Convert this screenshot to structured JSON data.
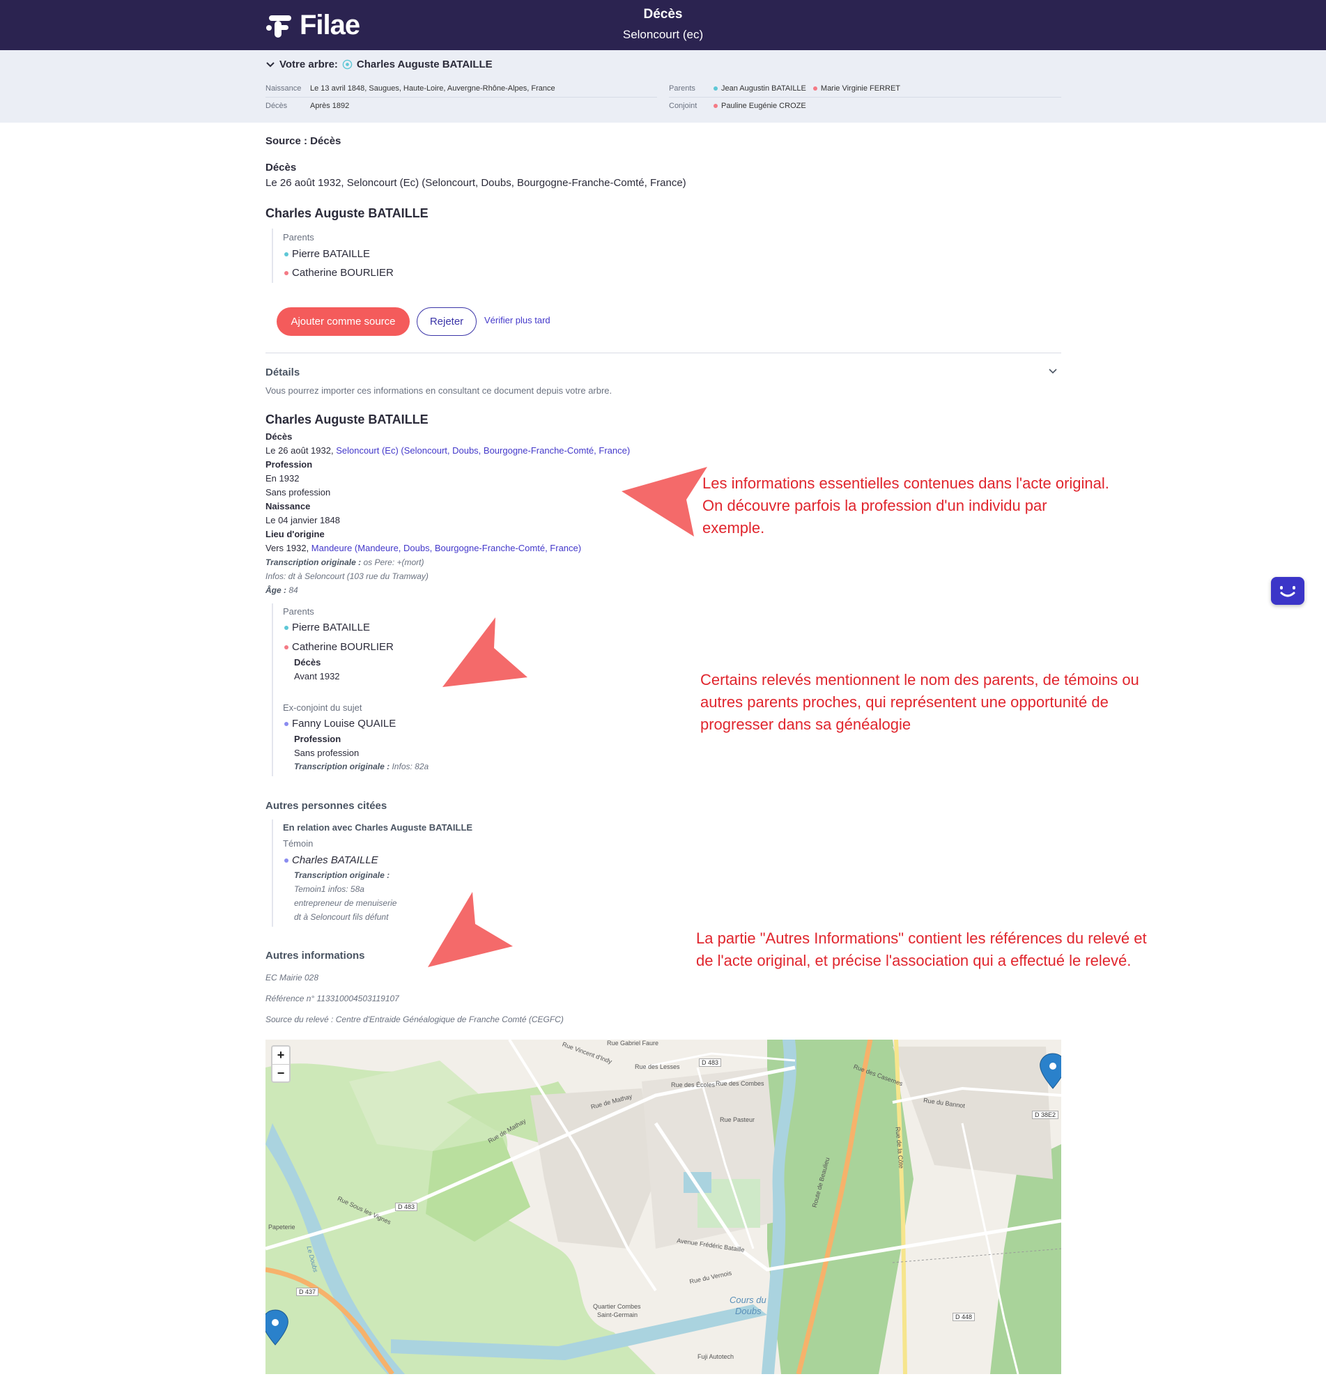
{
  "header": {
    "logo_text": "Filae",
    "title": "Décès",
    "subtitle": "Seloncourt (ec)"
  },
  "tree": {
    "heading_label": "Votre arbre:",
    "person_name": "Charles Auguste BATAILLE",
    "birth_label": "Naissance",
    "birth_value": "Le 13 avril 1848, Saugues, Haute-Loire, Auvergne-Rhône-Alpes, France",
    "death_label": "Décès",
    "death_value": "Après 1892",
    "parents_label": "Parents",
    "father": "Jean Augustin BATAILLE",
    "mother": "Marie Virginie FERRET",
    "spouse_label": "Conjoint",
    "spouse": "Pauline Eugénie CROZE"
  },
  "source": {
    "label": "Source : Décès",
    "event_label": "Décès",
    "event_value": "Le 26 août 1932, Seloncourt (Ec) (Seloncourt, Doubs, Bourgogne-Franche-Comté, France)",
    "person_name": "Charles Auguste BATAILLE",
    "parents_label": "Parents",
    "father": "Pierre BATAILLE",
    "mother": "Catherine BOURLIER"
  },
  "actions": {
    "add_label": "Ajouter comme source",
    "reject_label": "Rejeter",
    "later_label": "Vérifier plus tard"
  },
  "details": {
    "title": "Détails",
    "subtitle": "Vous pourrez importer ces informations en consultant ce document depuis votre arbre.",
    "person_name": "Charles Auguste BATAILLE",
    "death_label": "Décès",
    "death_prefix": "Le 26 août 1932, ",
    "death_place": "Seloncourt (Ec) (Seloncourt, Doubs, Bourgogne-Franche-Comté, France)",
    "profession_label": "Profession",
    "profession_year": "En 1932",
    "profession_value": "Sans profession",
    "birth_label": "Naissance",
    "birth_value": "Le 04 janvier 1848",
    "origin_label": "Lieu d'origine",
    "origin_prefix": "Vers 1932, ",
    "origin_place": "Mandeure (Mandeure, Doubs, Bourgogne-Franche-Comté, France)",
    "transcription_label": "Transcription originale :",
    "transcription_value": " os Pere: +(mort)",
    "infos_value": "Infos: dt à Seloncourt (103 rue du Tramway)",
    "age_label": "Âge :",
    "age_value": " 84",
    "parents_label": "Parents",
    "father": "Pierre BATAILLE",
    "mother": "Catherine BOURLIER",
    "mother_death_label": "Décès",
    "mother_death_value": "Avant 1932",
    "exspouse_label": "Ex-conjoint du sujet",
    "exspouse_name": "Fanny Louise QUAILE",
    "exspouse_prof_label": "Profession",
    "exspouse_prof_value": "Sans profession",
    "exspouse_trans_label": "Transcription originale :",
    "exspouse_trans_value": " Infos: 82a"
  },
  "others": {
    "title": "Autres personnes citées",
    "relation_label": "En relation avec Charles Auguste BATAILLE",
    "role": "Témoin",
    "name": "Charles BATAILLE",
    "trans_label": "Transcription originale :",
    "line1": "Temoin1 infos: 58a",
    "line2": "entrepreneur de menuiserie",
    "line3": "dt à Seloncourt fils défunt"
  },
  "more_info": {
    "title": "Autres informations",
    "line1": "EC Mairie 028",
    "line2": "Référence n° 113310004503119107",
    "line3": "Source du relevé : Centre d'Entraide Généalogique de Franche Comté (CEGFC)"
  },
  "annotations": {
    "a1_line1": "Les informations essentielles contenues dans l'acte original.",
    "a1_line2": "On découvre parfois la profession d'un individu par",
    "a1_line3": "exemple.",
    "a2_line1": "Certains relevés mentionnent le nom des parents, de témoins ou",
    "a2_line2": "autres parents proches, qui représentent une opportunité de",
    "a2_line3": "progresser dans sa généalogie",
    "a3_line1": "La partie \"Autres Informations\" contient les références du relevé et",
    "a3_line2": "de l'acte original, et précise l'association qui a effectué le relevé."
  },
  "map": {
    "zoom_in": "+",
    "zoom_out": "−",
    "labels": {
      "road_d483a": "D 483",
      "road_d483b": "D 483",
      "road_d437": "D 437",
      "road_d448": "D 448",
      "road_d38e2": "D 38E2",
      "rue_mathay_a": "Rue de Mathay",
      "rue_mathay_b": "Rue de Mathay",
      "rue_vignes": "Rue Sous les Vignes",
      "quartier": "Quartier Combes",
      "saint_germain": "Saint-Germain",
      "cours_doubs": "Cours du",
      "doubs": "Doubs",
      "le_doubs": "Le Doubs",
      "papeterie": "Papeterie",
      "rue_ecoles": "Rue des Écoles",
      "rue_combes": "Rue des Combes",
      "rue_pasteur": "Rue Pasteur",
      "rue_vernois": "Rue du Vernois",
      "av_frederic": "Avenue Frédéric Bataille",
      "rue_bannot": "Rue du Bannot",
      "rue_casernes": "Rue des Casernes",
      "rue_cote": "Rue de la Côte",
      "route_beaulieu": "Route de Beaulieu",
      "fuji": "Fuji Autotech",
      "rue_lessas": "Rue des Lesses",
      "rue_gabriel": "Rue Gabriel Faure",
      "rue_vincent": "Rue Vincent d'Indy"
    }
  },
  "colors": {
    "header_bg": "#2b2350",
    "accent_red": "#f45b5b",
    "accent_indigo": "#3b35a8",
    "annotation_red": "#e0262e",
    "male_dot": "#5ec7d6",
    "female_dot": "#f47a85"
  }
}
